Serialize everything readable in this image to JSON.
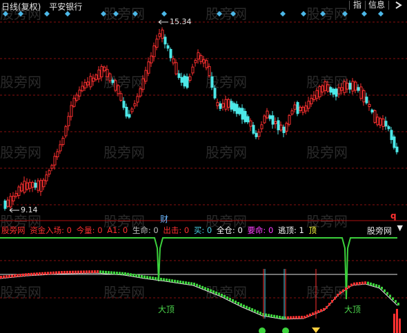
{
  "header": {
    "period_label": "日线(复权)",
    "stock_name": "平安银行",
    "tabs": [
      "指",
      "信息"
    ],
    "arrow_icon": "chevron-right-icon"
  },
  "watermark": "股旁网",
  "price_panel": {
    "high_label": "15.34",
    "low_label": "9.14",
    "cai_label": "财",
    "q_label": "q"
  },
  "indicator": {
    "logo": "股旁网",
    "items": [
      {
        "label": "股旁网",
        "color": "#ff3030"
      },
      {
        "label": "资金入场: 0",
        "color": "#ff3030"
      },
      {
        "label": "今量: 0",
        "color": "#ff3030"
      },
      {
        "label": "A1: 0",
        "color": "#ff3030"
      },
      {
        "label": "生命: 0",
        "color": "#bdbdbd"
      },
      {
        "label": "出击: 0",
        "color": "#ff3030"
      },
      {
        "label": "买: 0",
        "color": "#4cd3e8"
      },
      {
        "label": "全仓: 0",
        "color": "#ffffff"
      },
      {
        "label": "要命: 0",
        "color": "#ff40ff"
      },
      {
        "label": "逃顶: 1",
        "color": "#ffffff"
      },
      {
        "label": "顶",
        "color": "#ffff40"
      }
    ],
    "dading_label": "大顶"
  },
  "colors": {
    "up": "#ff3030",
    "down": "#4ce8e8",
    "grid": "#9a1010",
    "accent": "#4cd3e8"
  }
}
